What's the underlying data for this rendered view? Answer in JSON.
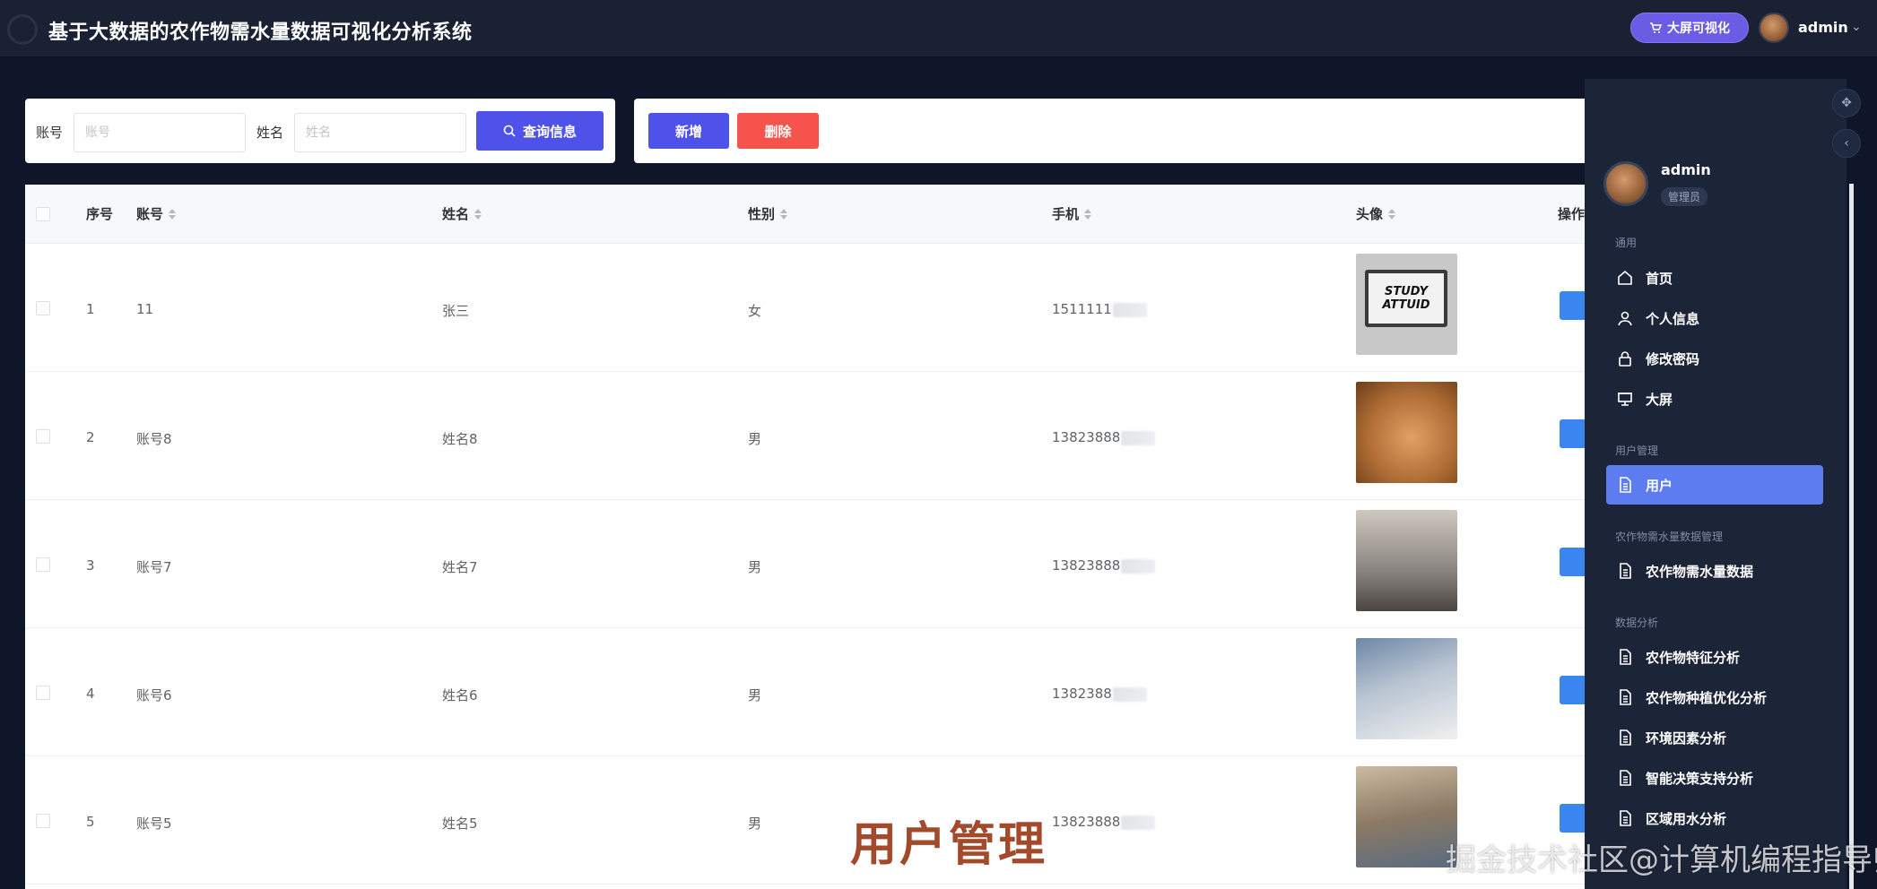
{
  "header": {
    "title": "基于大数据的农作物需水量数据可视化分析系统",
    "bigscreen_label": "大屏可视化",
    "username": "admin"
  },
  "filter": {
    "account_label": "账号",
    "account_placeholder": "账号",
    "name_label": "姓名",
    "name_placeholder": "姓名",
    "search_label": "查询信息"
  },
  "actions": {
    "add_label": "新增",
    "delete_label": "删除"
  },
  "table": {
    "columns": [
      "序号",
      "账号",
      "姓名",
      "性别",
      "手机",
      "头像",
      "操作"
    ],
    "rows": [
      {
        "index": "1",
        "account": "11",
        "name": "张三",
        "gender": "女",
        "phone": "1511111"
      },
      {
        "index": "2",
        "account": "账号8",
        "name": "姓名8",
        "gender": "男",
        "phone": "13823888"
      },
      {
        "index": "3",
        "account": "账号7",
        "name": "姓名7",
        "gender": "男",
        "phone": "13823888"
      },
      {
        "index": "4",
        "account": "账号6",
        "name": "姓名6",
        "gender": "男",
        "phone": "1382388"
      },
      {
        "index": "5",
        "account": "账号5",
        "name": "姓名5",
        "gender": "男",
        "phone": "13823888"
      }
    ],
    "row1_image_text": "STUDY ATTUID"
  },
  "sidebar": {
    "username": "admin",
    "role": "管理员",
    "groups": [
      {
        "label": "通用",
        "items": [
          "首页",
          "个人信息",
          "修改密码",
          "大屏"
        ]
      },
      {
        "label": "用户管理",
        "items": [
          "用户"
        ]
      },
      {
        "label": "农作物需水量数据管理",
        "items": [
          "农作物需水量数据"
        ]
      },
      {
        "label": "数据分析",
        "items": [
          "农作物特征分析",
          "农作物种植优化分析",
          "环境因素分析",
          "智能决策支持分析",
          "区域用水分析"
        ]
      }
    ]
  },
  "overlay": {
    "caption": "用户管理",
    "watermark": "掘金技术社区@计算机编程指导师"
  },
  "colors": {
    "primary": "#4f52e8",
    "danger": "#f5534b",
    "sidebar_active": "#5c7cf0",
    "header_bg": "#1a2133"
  }
}
